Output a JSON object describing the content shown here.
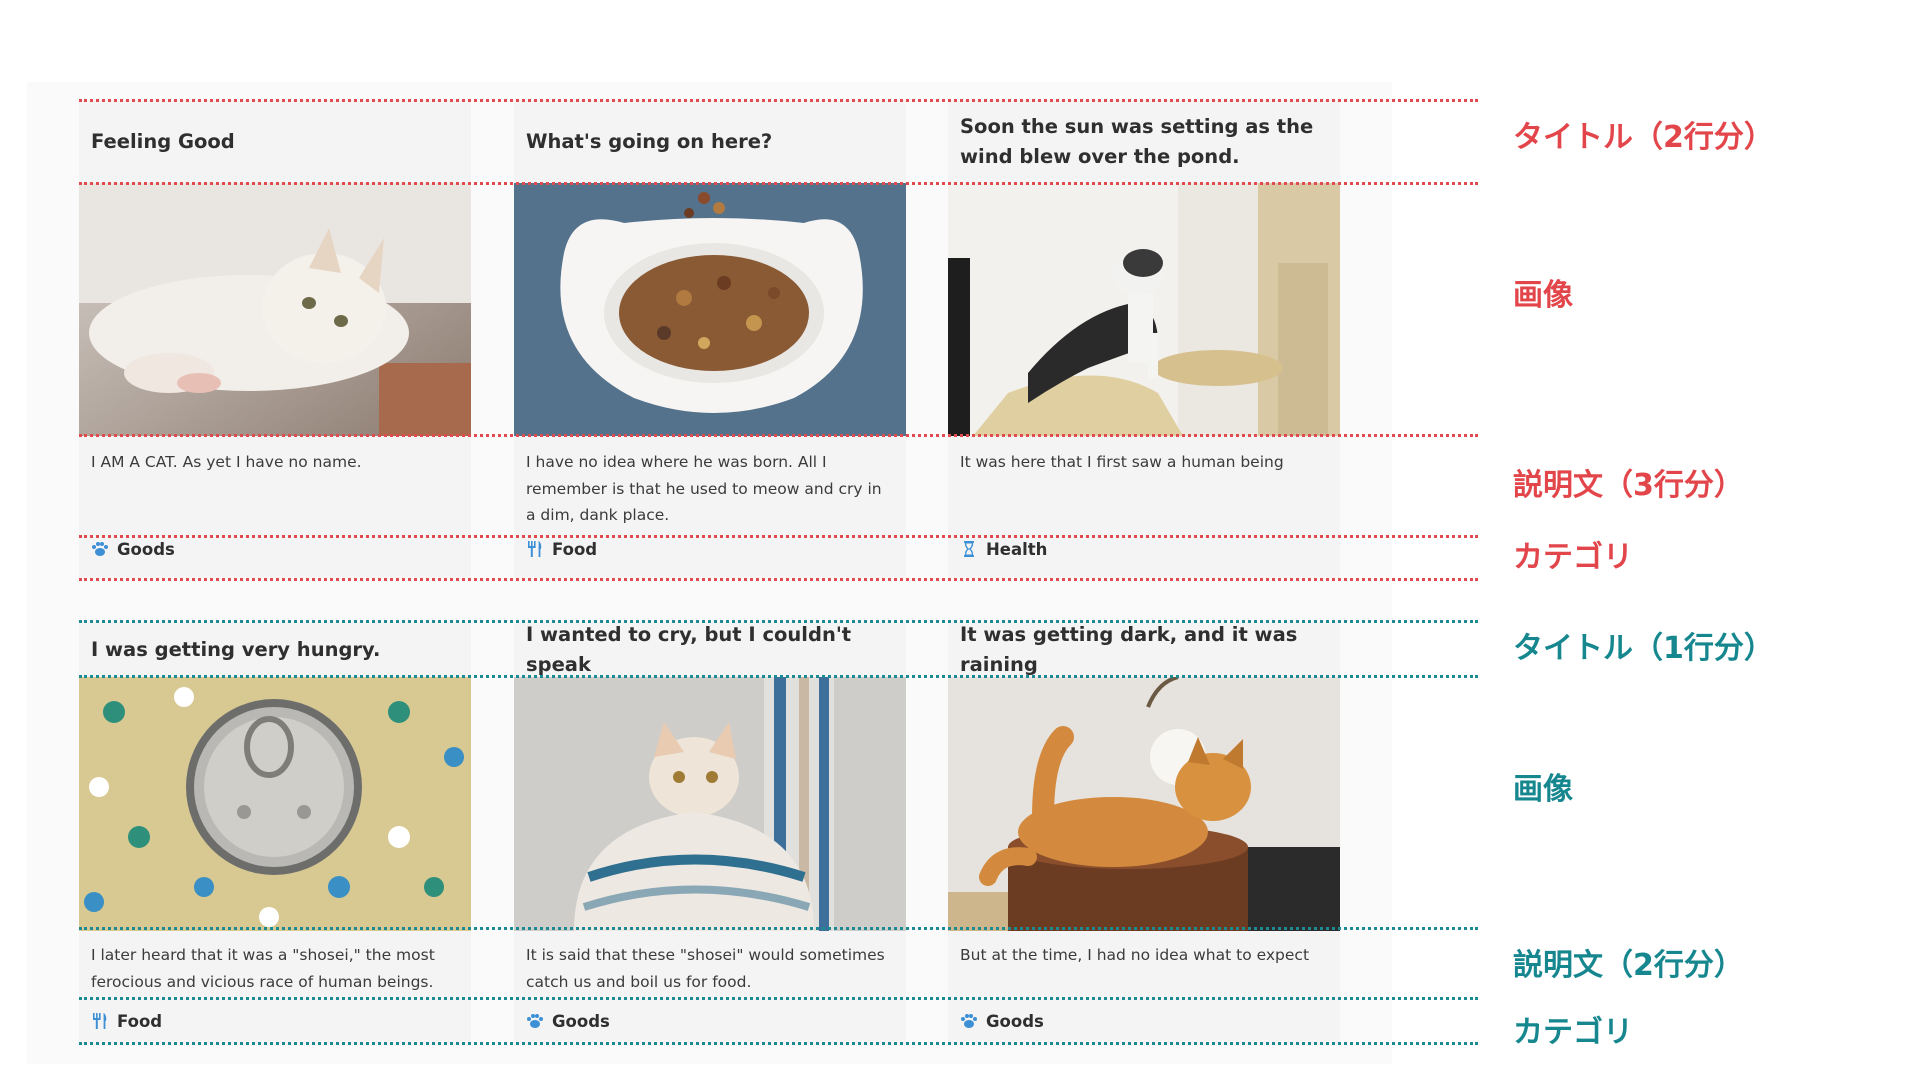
{
  "row1": {
    "cards": [
      {
        "title": "Feeling Good",
        "description": "I AM A CAT. As yet I have no name.",
        "category": "Goods",
        "category_icon": "paw-icon"
      },
      {
        "title": "What's going on here?",
        "description": "I have no idea where he was born. All I remember is that he used to meow and cry in a dim, dank place.",
        "category": "Food",
        "category_icon": "fork-knife-icon"
      },
      {
        "title": "Soon the sun was setting as the wind blew over the pond.",
        "description": "It was here that I first saw a human being",
        "category": "Health",
        "category_icon": "hourglass-icon"
      }
    ]
  },
  "row2": {
    "cards": [
      {
        "title": "I was getting very hungry.",
        "description": "I later heard that it was a \"shosei,\" the most ferocious and vicious race of human beings.",
        "category": "Food",
        "category_icon": "fork-knife-icon"
      },
      {
        "title": "I wanted to cry, but I couldn't speak",
        "description": "It is said that these \"shosei\" would sometimes catch us and boil us for food.",
        "category": "Goods",
        "category_icon": "paw-icon"
      },
      {
        "title": "It was getting dark, and it was raining",
        "description": "But at the time, I had no idea what to expect",
        "category": "Goods",
        "category_icon": "paw-icon"
      }
    ]
  },
  "annotations": {
    "red": {
      "title": "タイトル（2行分）",
      "image": "画像",
      "description": "説明文（3行分）",
      "category": "カテゴリ"
    },
    "teal": {
      "title": "タイトル（1行分）",
      "image": "画像",
      "description": "説明文（2行分）",
      "category": "カテゴリ"
    }
  },
  "colors": {
    "annotation_red": "#e2464b",
    "annotation_teal": "#17878f",
    "category_icon": "#3d8fd6",
    "card_bg": "#f5f4f4"
  }
}
